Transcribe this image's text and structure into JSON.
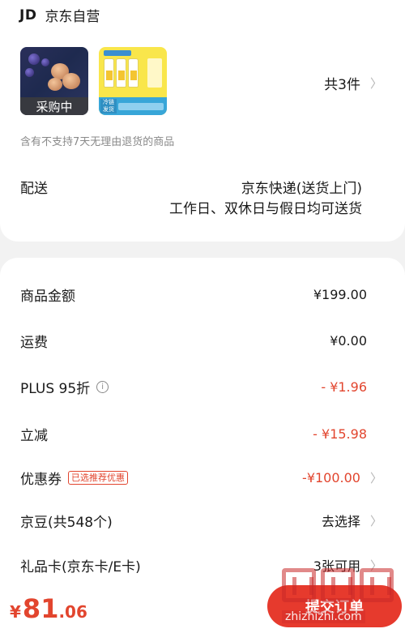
{
  "shop": {
    "logo": "JD",
    "name": "京东自营"
  },
  "products": {
    "first_badge": "采购中",
    "second_tag": "冷链发货",
    "count_label": "共3件"
  },
  "notice": "含有不支持7天无理由退货的商品",
  "delivery": {
    "label": "配送",
    "method": "京东快递(送货上门)",
    "schedule": "工作日、双休日与假日均可送货"
  },
  "pricing": [
    {
      "label": "商品金额",
      "value": "¥199.00"
    },
    {
      "label": "运费",
      "value": "¥0.00"
    },
    {
      "label": "PLUS 95折",
      "value": "- ¥1.96"
    },
    {
      "label": "立减",
      "value": "- ¥15.98"
    },
    {
      "label": "优惠券",
      "tag": "已选推荐优惠",
      "value": "-¥100.00"
    },
    {
      "label": "京豆(共548个)",
      "value": "去选择"
    },
    {
      "label": "礼品卡(京东卡/E卡)",
      "value": "3张可用"
    }
  ],
  "footer": {
    "currency": "¥",
    "amount_int": "81",
    "amount_dec": ".06",
    "submit_label": "提交订单"
  },
  "watermark": {
    "text": "zhizhizhi.com"
  },
  "colors": {
    "accent": "#e2452e",
    "button": "#e63a2d",
    "background": "#f2f2f2"
  }
}
